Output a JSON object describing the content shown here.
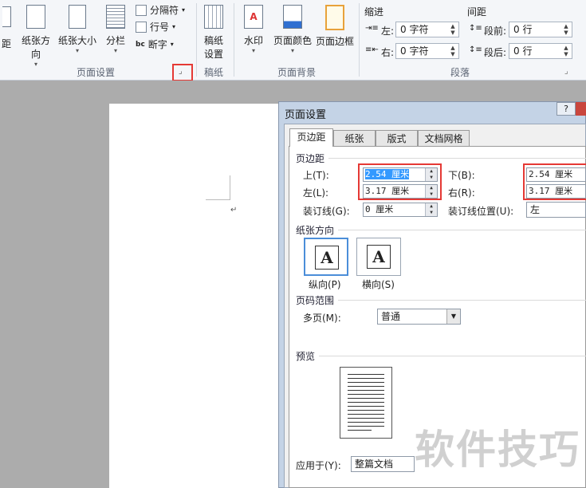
{
  "ribbon": {
    "page_setup": {
      "margins_partial": "距",
      "orientation": "纸张方向",
      "size": "纸张大小",
      "columns": "分栏",
      "breaks": "分隔符",
      "line_numbers": "行号",
      "hyphenation": "断字",
      "group_label": "页面设置",
      "launcher": "⌟"
    },
    "manuscript": {
      "btn1": "稿纸",
      "btn2": "设置",
      "group_label": "稿纸"
    },
    "background": {
      "watermark": "水印",
      "page_color": "页面颜色",
      "page_border": "页面边框",
      "group_label": "页面背景"
    },
    "paragraph": {
      "indent_title": "缩进",
      "spacing_title": "间距",
      "left_label": "左:",
      "left_value": "0 字符",
      "right_label": "右:",
      "right_value": "0 字符",
      "before_label": "段前:",
      "before_value": "0 行",
      "after_label": "段后:",
      "after_value": "0 行",
      "group_label": "段落"
    }
  },
  "document": {
    "return_mark": "↵"
  },
  "dialog": {
    "title": "页面设置",
    "help": "?",
    "tabs": [
      "页边距",
      "纸张",
      "版式",
      "文档网格"
    ],
    "margins_header": "页边距",
    "top_label": "上(T):",
    "top_value_num": "2.54",
    "top_value_unit": " 厘米",
    "bottom_label": "下(B):",
    "bottom_value": "2.54 厘米",
    "left_label": "左(L):",
    "left_value": "3.17 厘米",
    "right_label": "右(R):",
    "right_value": "3.17 厘米",
    "gutter_label": "装订线(G):",
    "gutter_value": "0 厘米",
    "gutter_pos_label": "装订线位置(U):",
    "gutter_pos_value": "左",
    "orientation_header": "纸张方向",
    "portrait": "纵向(P)",
    "landscape": "横向(S)",
    "orient_glyph": "A",
    "pages_header": "页码范围",
    "multiple_pages_label": "多页(M):",
    "multiple_pages_value": "普通",
    "preview_header": "预览",
    "apply_to_label": "应用于(Y):",
    "apply_to_value": "整篇文档"
  },
  "watermark_text": "软件技巧",
  "colors": {
    "highlight_box": "#e53935",
    "selection": "#3399ff"
  }
}
